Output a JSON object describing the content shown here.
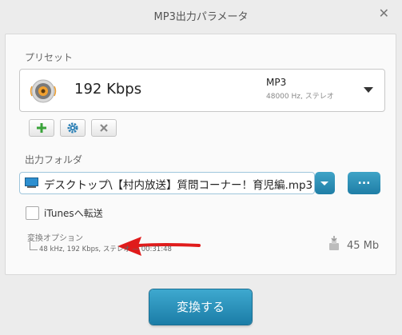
{
  "window": {
    "title": "MP3出力パラメータ",
    "close_glyph": "✕"
  },
  "preset": {
    "label": "プリセット",
    "bitrate": "192 Kbps",
    "format": "MP3",
    "format_detail": "48000 Hz,  ステレオ",
    "icon": "speaker-icon"
  },
  "preset_actions": [
    {
      "name": "add-preset-button",
      "icon": "plus-icon",
      "color": "#3aa33a"
    },
    {
      "name": "preset-settings-button",
      "icon": "gear-icon",
      "color": "#2a7fb5"
    },
    {
      "name": "delete-preset-button",
      "icon": "close-icon",
      "color": "#888888"
    }
  ],
  "output_folder": {
    "label": "出力フォルダ",
    "path": "デスクトップ\\【村内放送】質問コーナー！育児編.mp3",
    "browse_label": "..."
  },
  "itunes": {
    "label": "iTunesへ転送",
    "checked": false
  },
  "conversion_options": {
    "label": "変換オプション",
    "detail": "48 kHz, 192 Kbps, ステレオ — 00:31:48"
  },
  "estimated_size": "45 Mb",
  "convert_button": "変換する",
  "colors": {
    "accent": "#2a8cb6",
    "annotation_arrow": "#e01b1b"
  }
}
